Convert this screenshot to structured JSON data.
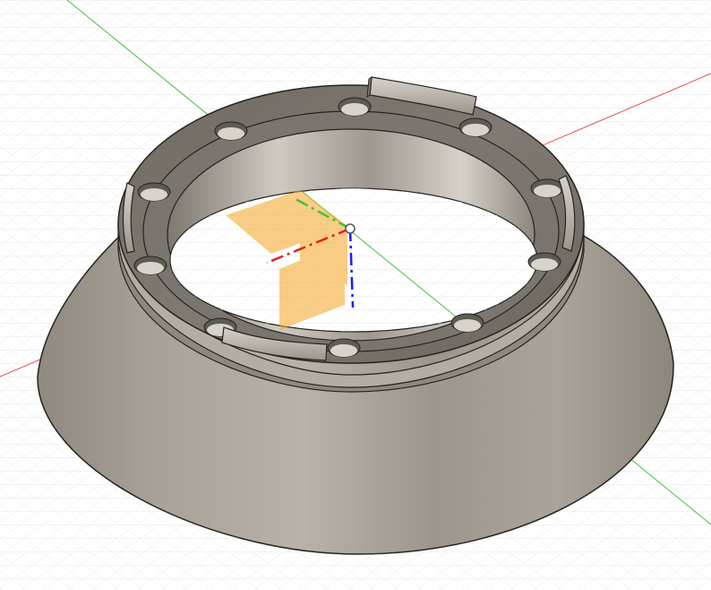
{
  "viewport": {
    "background": "#ffffff",
    "grid_minor_color": "#e4e4e4",
    "grid_major_color": "#cfcfcf"
  },
  "axes": {
    "x_color": "#e05050",
    "y_color": "#3cc43c",
    "z_color": "#1a1aff"
  },
  "model": {
    "type": "conical flange adapter",
    "body_color": "#a59f95",
    "edge_color": "#262320",
    "bolt_hole_count": 10,
    "tab_count": 4
  },
  "origin": {
    "plane_color": "#f5a623",
    "plane_opacity": 0.55
  }
}
